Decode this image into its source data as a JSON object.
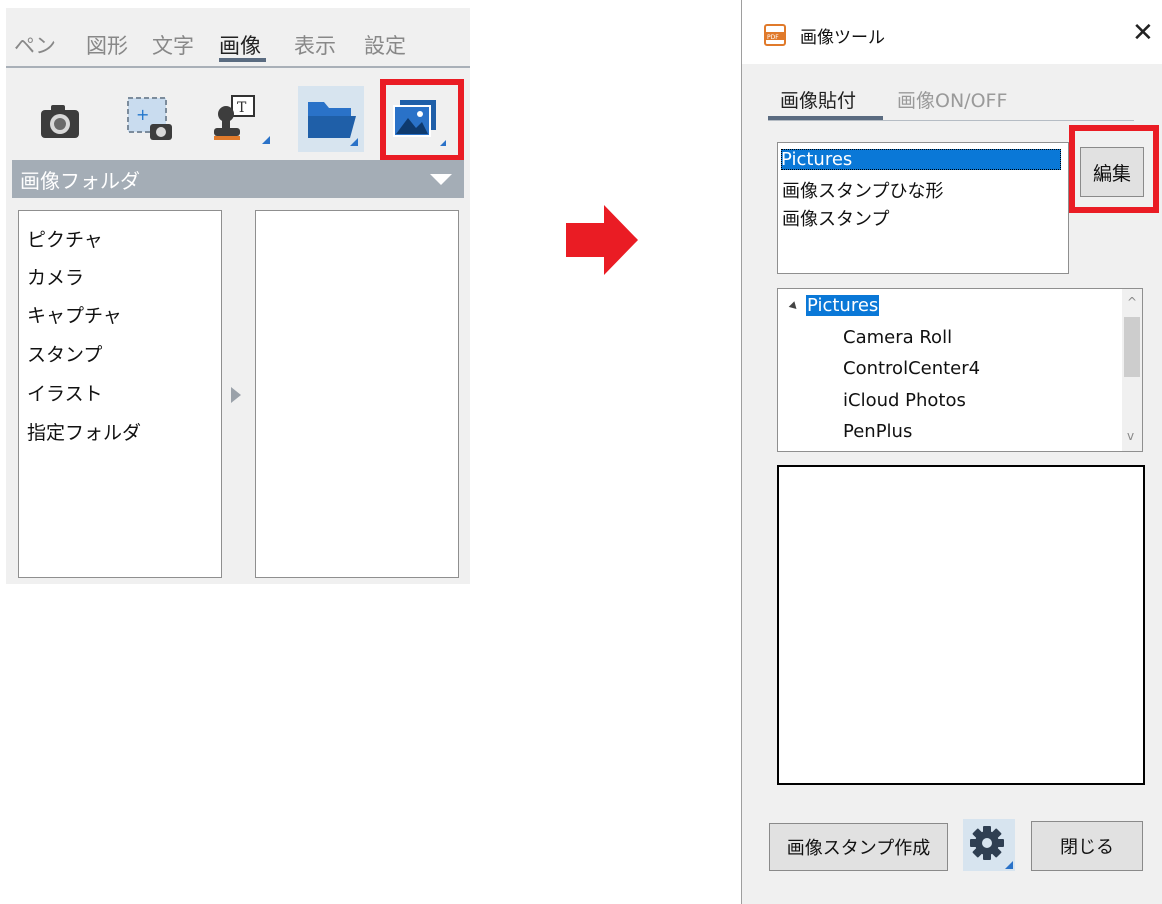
{
  "left_panel": {
    "tabs": [
      "ペン",
      "図形",
      "文字",
      "画像",
      "表示",
      "設定"
    ],
    "active_tab": "画像",
    "folder_header": "画像フォルダ",
    "folder_items": [
      "ピクチャ",
      "カメラ",
      "キャプチャ",
      "スタンプ",
      "イラスト",
      "指定フォルダ"
    ]
  },
  "dialog": {
    "title": "画像ツール",
    "close_glyph": "✕",
    "tabs": {
      "paste": "画像貼付",
      "onoff": "画像ON/OFF"
    },
    "source_list": [
      "Pictures",
      "画像スタンプひな形",
      "画像スタンプ"
    ],
    "edit_button": "編集",
    "tree": {
      "root": "Pictures",
      "children": [
        "Camera Roll",
        "ControlCenter4",
        "iCloud Photos",
        "PenPlus"
      ]
    },
    "stamp_create_button": "画像スタンプ作成",
    "close_button": "閉じる"
  },
  "colors": {
    "highlight": "#ea1c24",
    "selection": "#0a78d7",
    "arrow": "#ea1c24"
  }
}
